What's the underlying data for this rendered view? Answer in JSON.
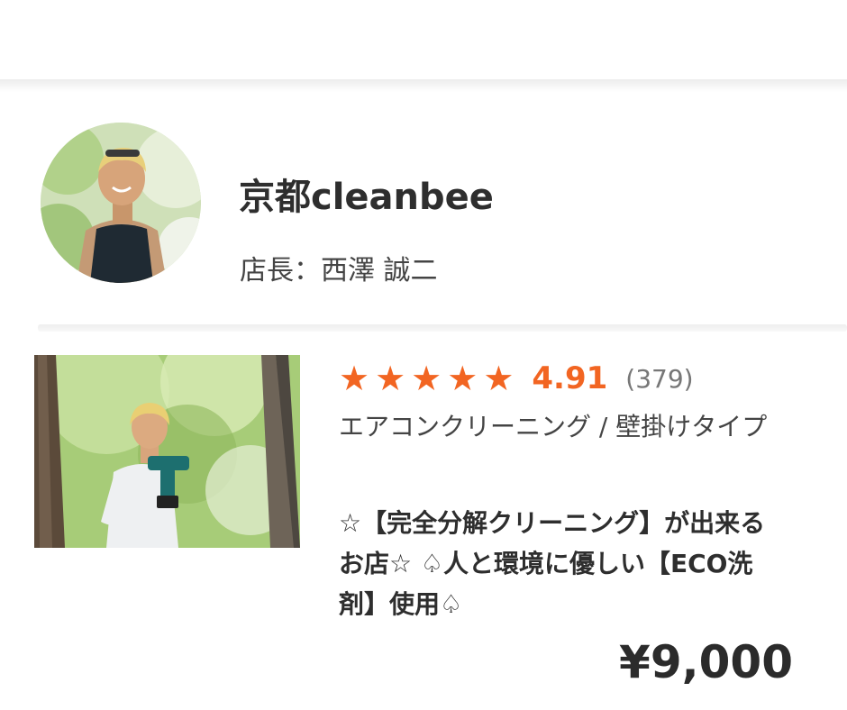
{
  "shop": {
    "name": "京都cleanbee",
    "manager": "店長：西澤 誠二"
  },
  "listing": {
    "rating": "4.91",
    "review_count": "(379)",
    "stars": [
      "★",
      "★",
      "★",
      "★",
      "★"
    ],
    "service": "エアコンクリーニング / 壁掛けタイプ",
    "description": "☆【完全分解クリーニング】が出来るお店☆ ♤人と環境に優しい【ECO洗剤】使用♤",
    "price": "¥9,000"
  },
  "colors": {
    "accent": "#f26522",
    "text_dark": "#2e2e2e",
    "text_muted": "#777777"
  },
  "icons": {
    "star": "star-icon"
  }
}
